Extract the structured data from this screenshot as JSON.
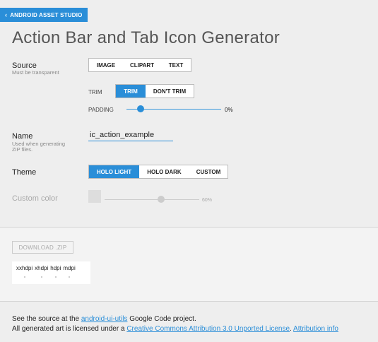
{
  "header": {
    "back_button_label": "ANDROID ASSET STUDIO",
    "title": "Action Bar and Tab Icon Generator"
  },
  "source": {
    "label": "Source",
    "sublabel": "Must be transparent",
    "options": [
      "IMAGE",
      "CLIPART",
      "TEXT"
    ],
    "trim_label": "TRIM",
    "trim_options": [
      "TRIM",
      "DON'T TRIM"
    ],
    "trim_selected": "TRIM",
    "padding_label": "PADDING",
    "padding_value": "0%",
    "padding_fraction": 0.0
  },
  "name": {
    "label": "Name",
    "sublabel_line1": "Used when generating",
    "sublabel_line2": "ZIP files.",
    "value": "ic_action_example"
  },
  "theme": {
    "label": "Theme",
    "options": [
      "HOLO LIGHT",
      "HOLO DARK",
      "CUSTOM"
    ],
    "selected": "HOLO LIGHT"
  },
  "custom_color": {
    "label": "Custom color",
    "opacity_value": "60%",
    "opacity_fraction": 0.6
  },
  "download": {
    "button_label": "DOWNLOAD .ZIP",
    "densities": [
      "xxhdpi",
      "xhdpi",
      "hdpi",
      "mdpi"
    ]
  },
  "footer": {
    "line1_pre": "See the source at the ",
    "line1_link": "android-ui-utils",
    "line1_post": " Google Code project.",
    "line2_pre": "All generated art is licensed under a ",
    "line2_link1": "Creative Commons Attribution 3.0 Unported License",
    "line2_mid": ". ",
    "line2_link2": "Attribution info"
  },
  "colors": {
    "accent": "#2a8ed8",
    "background": "#eeeeee"
  }
}
